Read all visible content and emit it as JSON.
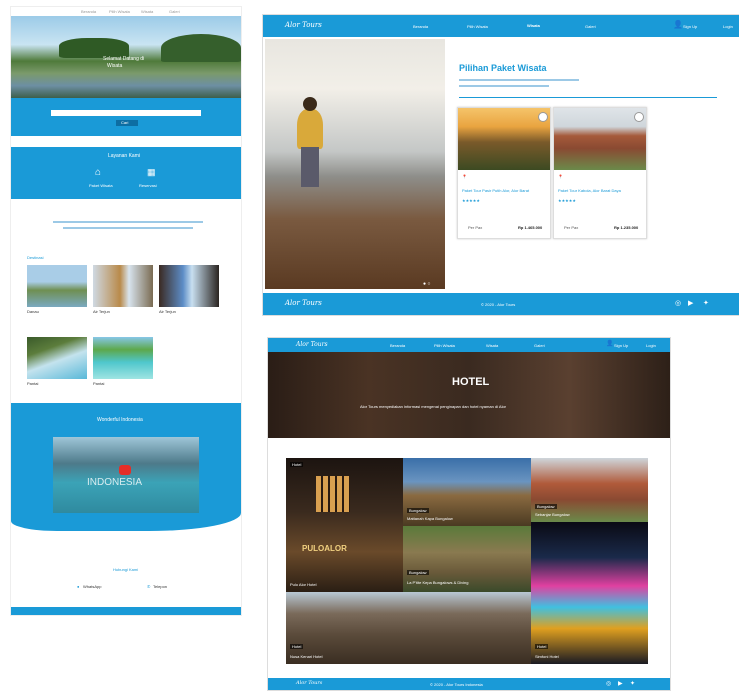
{
  "left_panel": {
    "top_nav": [
      "Beranda",
      "Pilih Wisata",
      "Wisata",
      "Galeri"
    ],
    "hero_text": [
      "Selamat Datang di",
      "Wisata"
    ],
    "search_button": "Cari",
    "section_title_services": "Layanan Kami",
    "services": [
      {
        "label": "Paket Wisata",
        "icon": "house-icon"
      },
      {
        "label": "Reservasi",
        "icon": "calendar-icon"
      }
    ],
    "destinations_title": "Destinasi",
    "destinations": [
      "Danau",
      "Air Terjun",
      "Air Terjun",
      "Pantai",
      "Pantai"
    ],
    "video_title": "Wonderful Indonesia",
    "video_overlay": "INDONESIA",
    "contact_title": "Hubungi Kami",
    "contacts": [
      "WhatsApp",
      "Telepon"
    ]
  },
  "top_right": {
    "brand": "Alor Tours",
    "nav": [
      "Beranda",
      "Pilih Wisata",
      "Wisata",
      "Galeri"
    ],
    "nav_active": "Wisata",
    "sign_up": "Sign Up",
    "login": "Login",
    "section_title": "Pilihan Paket Wisata",
    "cards": [
      {
        "title": "Paket Tour Pasir Putih Alor, Alor Barat",
        "rating": "★★★★★",
        "price": "Rp 1.465.000",
        "pax": "Per Pax"
      },
      {
        "title": "Paket Tour Kabola, Alor Barat Daya",
        "rating": "★★★★★",
        "price": "Rp 1.235.000",
        "pax": "Per Pax"
      }
    ],
    "footer_brand": "Alor Tours",
    "footer_copy": "© 2020 - Alor Tours",
    "footer_icons": [
      "instagram-icon",
      "youtube-icon",
      "twitter-icon"
    ]
  },
  "bottom_right": {
    "brand": "Alor Tours",
    "nav": [
      "Beranda",
      "Pilih Wisata",
      "Wisata",
      "Galeri"
    ],
    "sign_up": "Sign Up",
    "login": "Login",
    "hero_title": "HOTEL",
    "hero_text": "Alor Tours menyediakan informasi mengenai penginapan dan hotel nyaman di Alor",
    "tiles": [
      {
        "badge": "Hotel",
        "name": "Pulo Alor Hotel"
      },
      {
        "badge": "Bungalow",
        "name": "Mattanah Kapa Bungalow"
      },
      {
        "badge": "Bungalow",
        "name": "Sebanjar Bungalow"
      },
      {
        "badge": "Bungalow",
        "name": "La P'tite Kepa Bungalows & Diving"
      },
      {
        "badge": "Hotel",
        "name": "Nusa Kenari Hotel"
      },
      {
        "badge": "Hotel",
        "name": "Simfoni Hotel"
      }
    ],
    "hotel_sign": "PULOALOR",
    "footer_brand": "Alor Tours",
    "footer_copy": "© 2020 - Alor Tours Indonesia",
    "footer_icons": [
      "instagram-icon",
      "youtube-icon",
      "twitter-icon"
    ]
  },
  "colors": {
    "primary": "#1a9ad7",
    "white": "#ffffff",
    "dark": "#2a1f1a"
  }
}
